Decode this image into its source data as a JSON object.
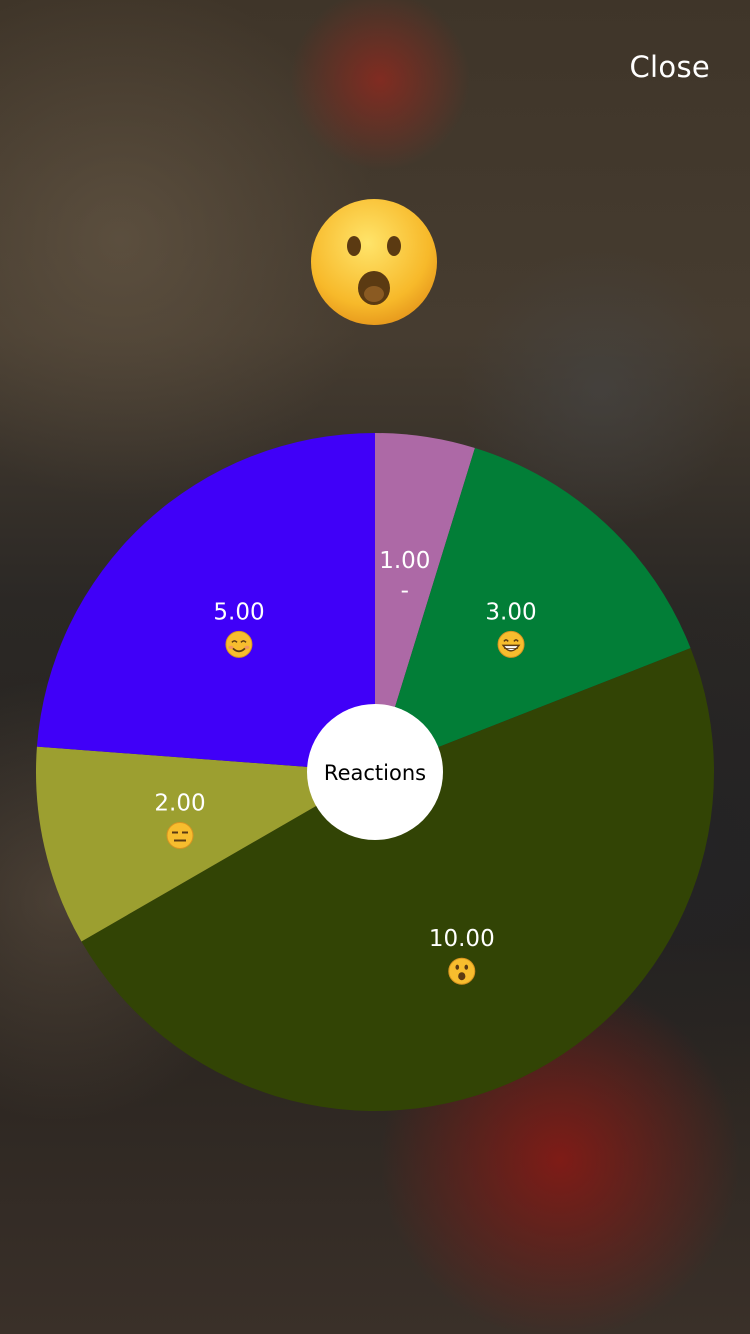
{
  "header": {
    "close_label": "Close"
  },
  "hero": {
    "emoji_icon": "hushed-face-icon"
  },
  "chart_data": {
    "type": "pie",
    "center_label": "Reactions",
    "slices": [
      {
        "value": 1,
        "label": "1.00",
        "reaction": "-",
        "reaction_icon": null,
        "color": "#ad69a6"
      },
      {
        "value": 3,
        "label": "3.00",
        "reaction": "grinning-face",
        "reaction_icon": "grinning-face-icon",
        "color": "#027e37"
      },
      {
        "value": 10,
        "label": "10.00",
        "reaction": "hushed-face",
        "reaction_icon": "hushed-face-icon",
        "color": "#324405"
      },
      {
        "value": 2,
        "label": "2.00",
        "reaction": "expressionless-face",
        "reaction_icon": "expressionless-face-icon",
        "color": "#9c9f30"
      },
      {
        "value": 5,
        "label": "5.00",
        "reaction": "smiling-face",
        "reaction_icon": "smiling-face-icon",
        "color": "#4000f8"
      }
    ]
  }
}
